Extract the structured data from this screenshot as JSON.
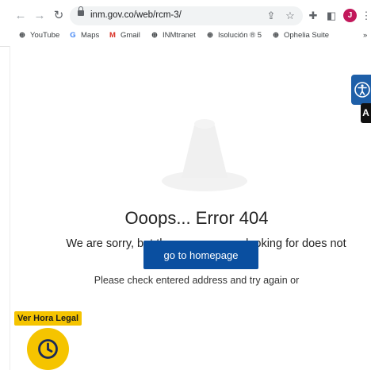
{
  "browser": {
    "url": "inm.gov.co/web/rcm-3/",
    "avatar_initial": "J",
    "bookmarks": [
      {
        "label": "YouTube",
        "icon": "globe-icon"
      },
      {
        "label": "Maps",
        "icon": "google-icon"
      },
      {
        "label": "Gmail",
        "icon": "gmail-icon"
      },
      {
        "label": "INMtranet",
        "icon": "globe-icon"
      },
      {
        "label": "Isolución ® 5",
        "icon": "globe-icon"
      },
      {
        "label": "Ophelia Suite",
        "icon": "globe-icon"
      }
    ],
    "more_bookmarks": "»"
  },
  "error_page": {
    "title": "Ooops... Error 404",
    "message": "We are sorry, but the page you are looking for does not exist.",
    "hint": "Please check entered address and try again or",
    "button_label": "go to homepage"
  },
  "widgets": {
    "hora_legal_label": "Ver Hora Legal",
    "accessibility_letter": "A"
  },
  "colors": {
    "primary_button": "#0a4fa0",
    "accent_yellow": "#f5c400",
    "accessibility_blue": "#1e5fa8",
    "avatar": "#c2185b"
  }
}
